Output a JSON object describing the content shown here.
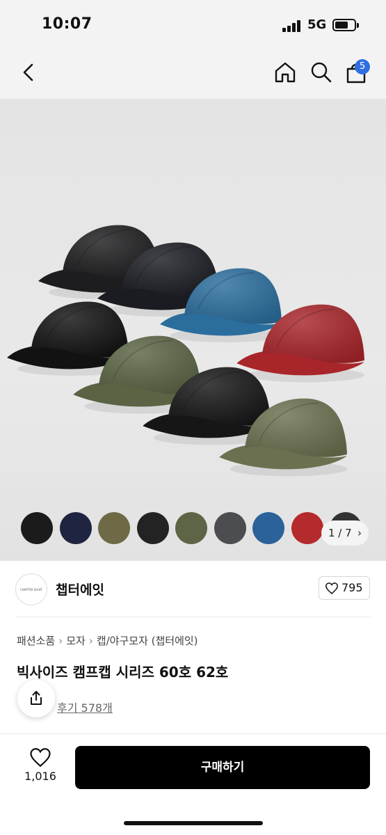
{
  "status_bar": {
    "time": "10:07",
    "network": "5G"
  },
  "nav": {
    "cart_count": "5"
  },
  "hero": {
    "caps": [
      {
        "color": "#1d1d1f"
      },
      {
        "color": "#1a1c22"
      },
      {
        "color": "#2b6e9e"
      },
      {
        "color": "#a8252a"
      },
      {
        "color": "#121212"
      },
      {
        "color": "#5a6444"
      },
      {
        "color": "#161616"
      },
      {
        "color": "#6b7150"
      }
    ],
    "swatches": [
      "#1b1b1b",
      "#1f2540",
      "#6e6a45",
      "#232323",
      "#5e6446",
      "#4b4d50",
      "#2a6299",
      "#b52a2c",
      "#333333"
    ],
    "pager": "1 / 7"
  },
  "brand": {
    "logo_text": "CHAPTER EIGHT",
    "name": "챕터에잇",
    "likes": "795"
  },
  "product": {
    "breadcrumb": [
      "패션소품",
      "모자",
      "캡/야구모자 (챕터에잇)"
    ],
    "title": "빅사이즈 캠프캡 시리즈 60호 62호",
    "reviews": "후기 578개"
  },
  "bottom": {
    "wish_count": "1,016",
    "buy_label": "구매하기"
  }
}
